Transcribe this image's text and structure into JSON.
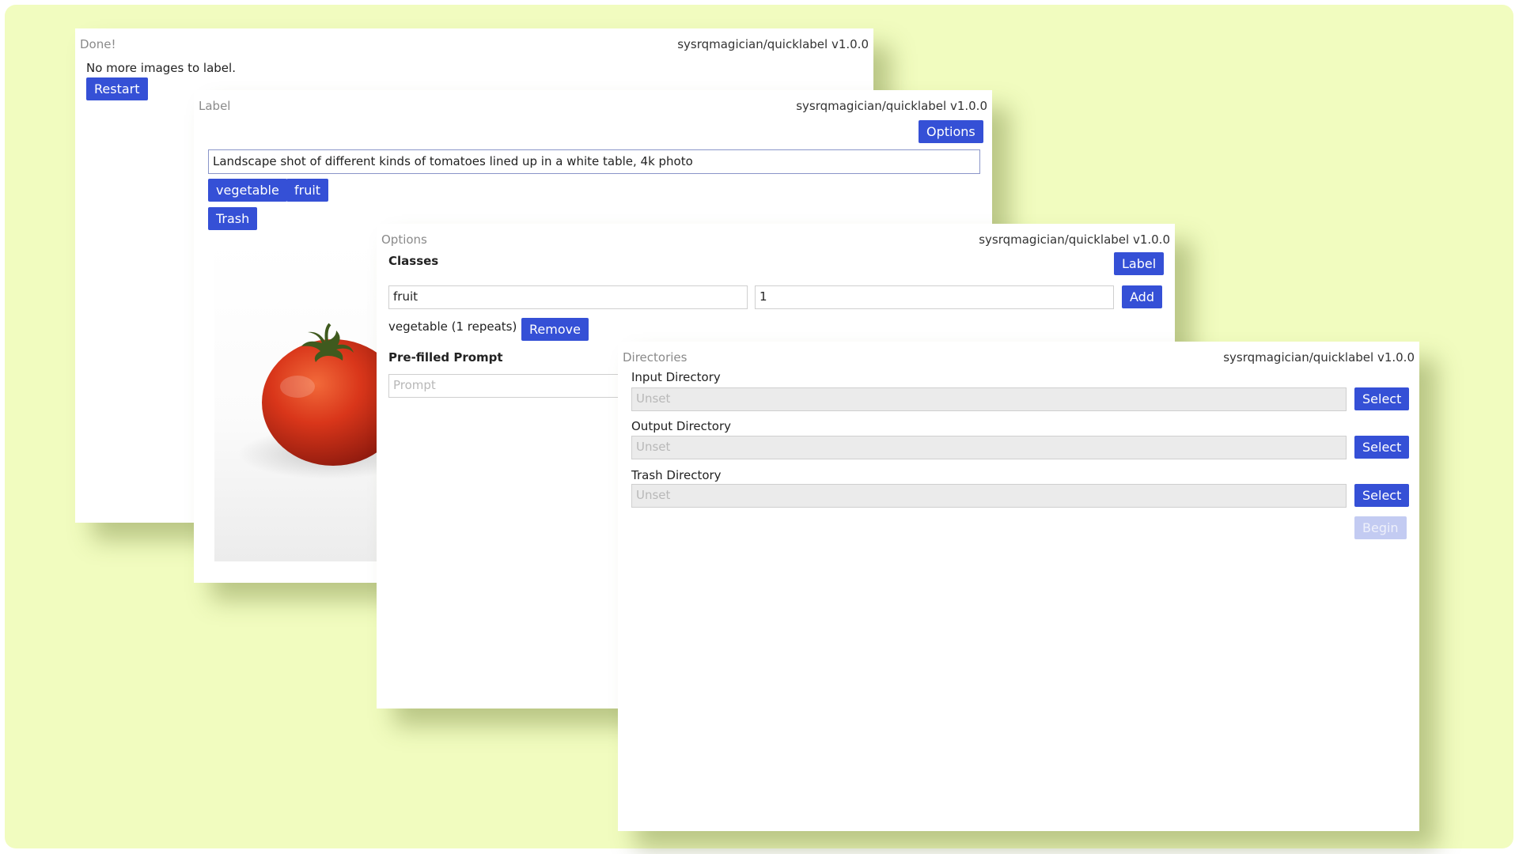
{
  "app_name": "sysrqmagician/quicklabel v1.0.0",
  "colors": {
    "accent": "#3550d6",
    "background": "#f1fcbf"
  },
  "done_window": {
    "title": "Done!",
    "message": "No more images to label.",
    "restart_label": "Restart"
  },
  "label_window": {
    "title": "Label",
    "options_label": "Options",
    "prompt_value": "Landscape shot of different kinds of tomatoes lined up in a white table, 4k photo",
    "class_buttons": [
      "vegetable",
      "fruit"
    ],
    "trash_label": "Trash",
    "image_subject": "tomato"
  },
  "options_window": {
    "title": "Options",
    "classes_heading": "Classes",
    "label_button": "Label",
    "class_name_value": "fruit",
    "repeat_value": "1",
    "add_label": "Add",
    "existing_class": "vegetable (1 repeats)",
    "remove_label": "Remove",
    "prefilled_heading": "Pre-filled Prompt",
    "prompt_placeholder": "Prompt"
  },
  "directories_window": {
    "title": "Directories",
    "input_label": "Input Directory",
    "output_label": "Output Directory",
    "trash_label": "Trash Directory",
    "unset_text": "Unset",
    "select_label": "Select",
    "begin_label": "Begin"
  }
}
